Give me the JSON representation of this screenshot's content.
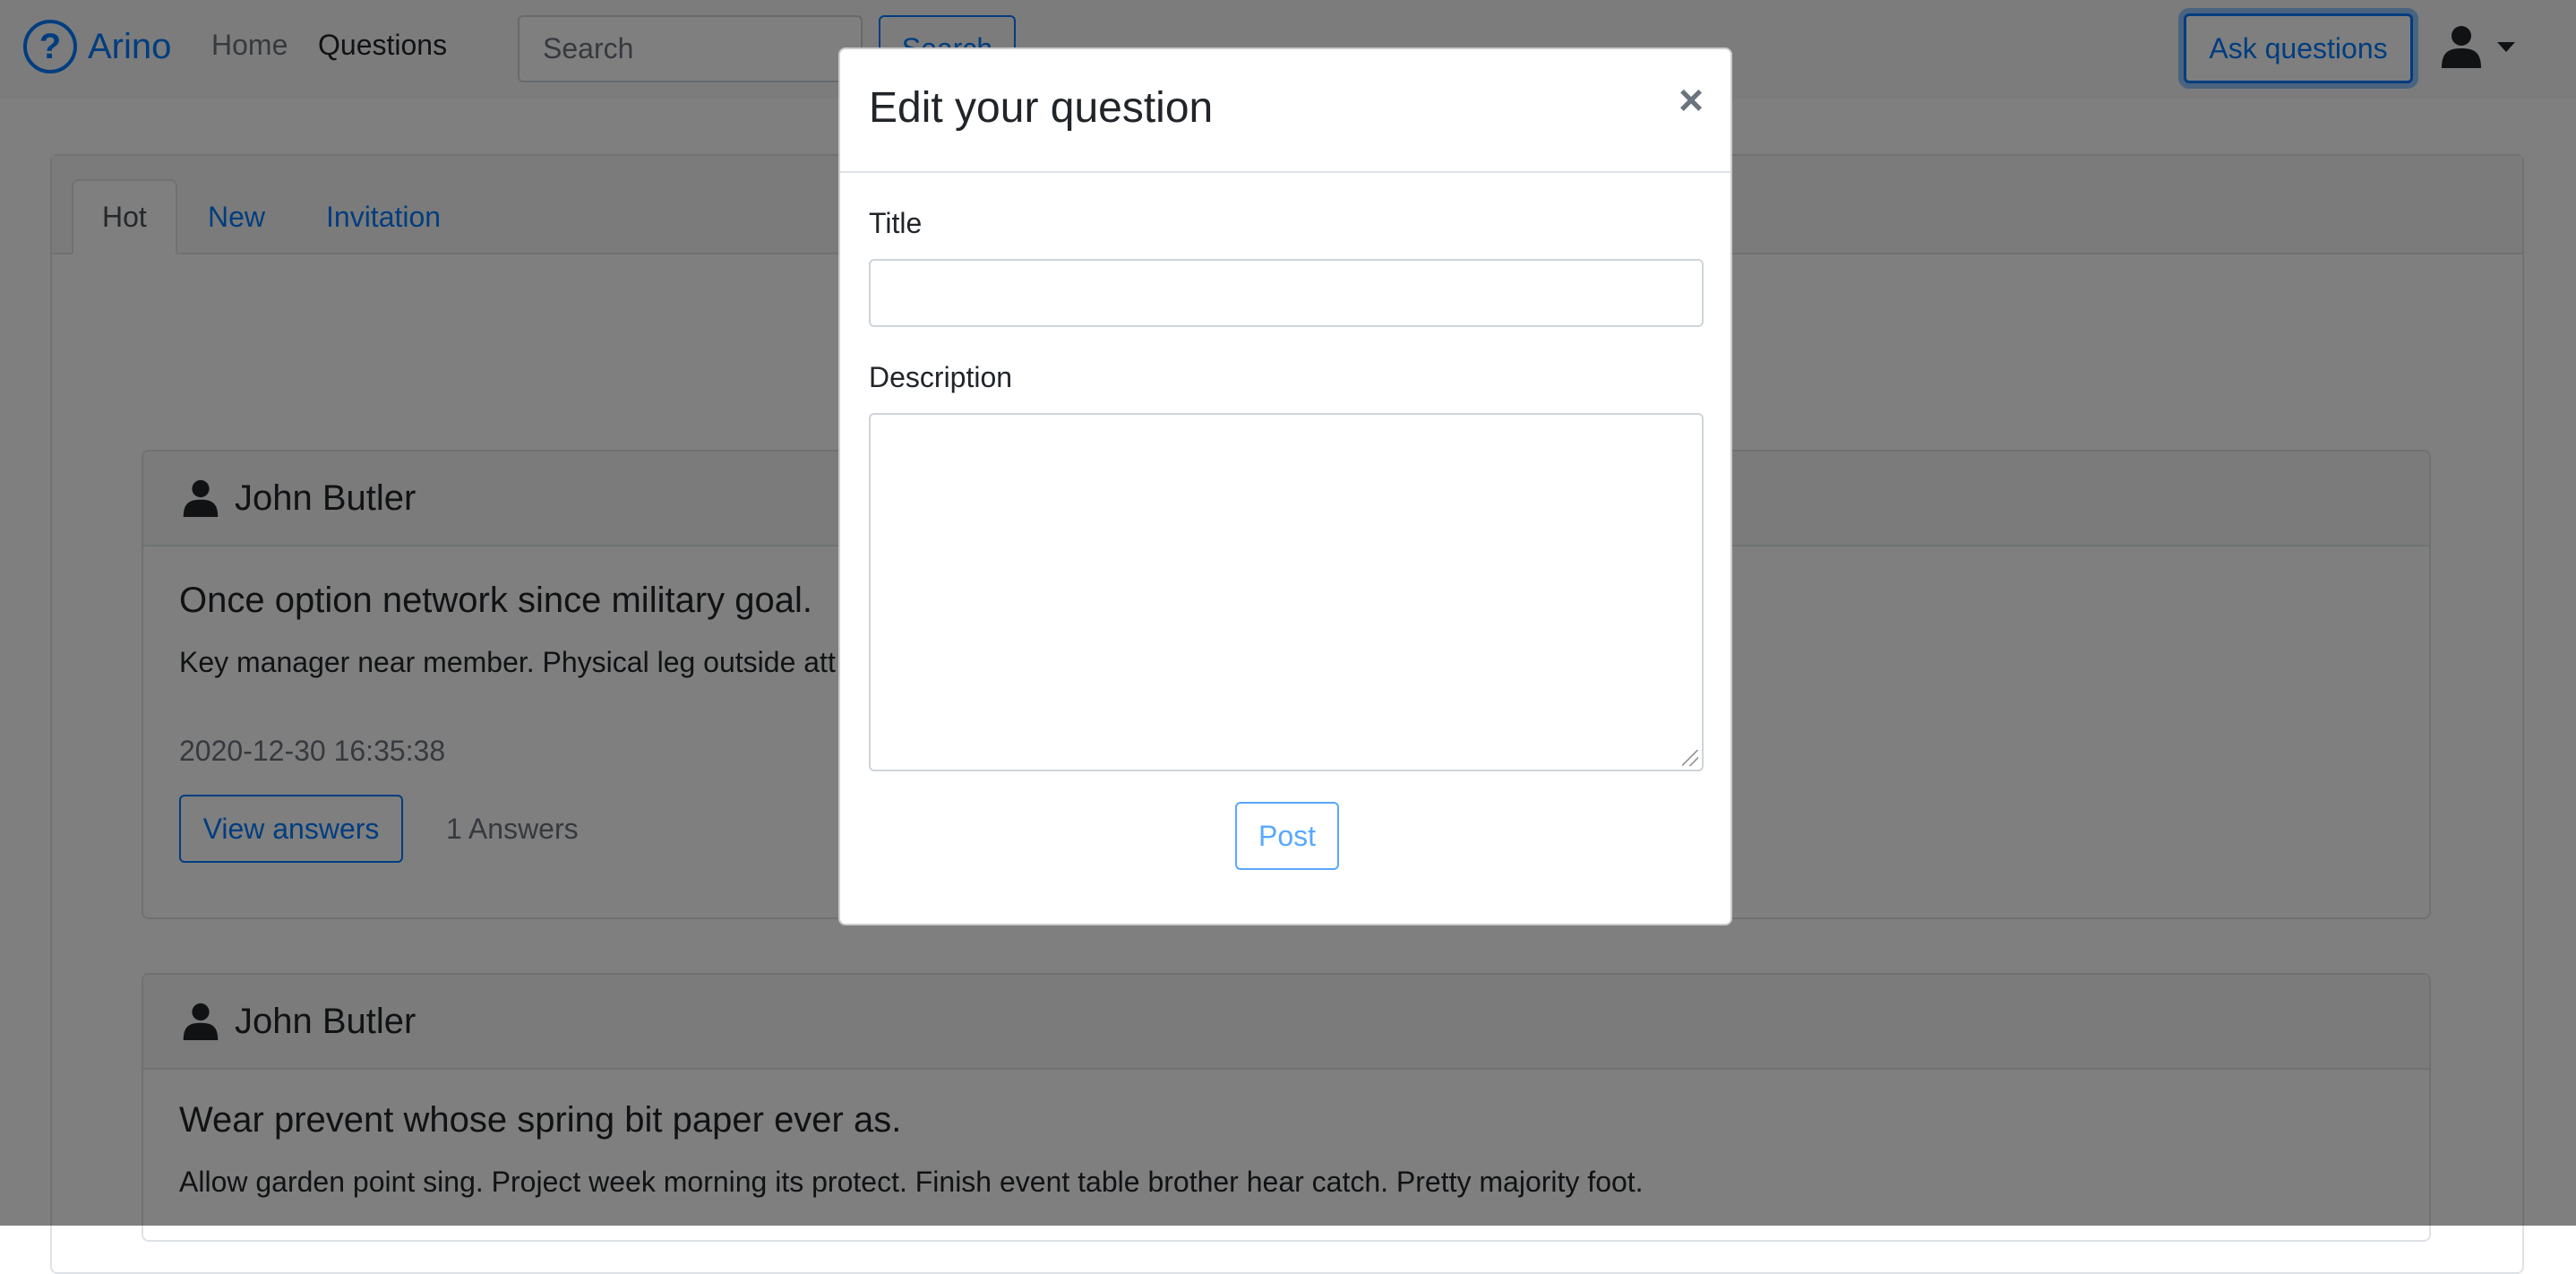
{
  "navbar": {
    "brand": "Arino",
    "brand_icon": "question-circle-icon",
    "links": [
      "Home",
      "Questions"
    ],
    "search_placeholder": "Search",
    "search_button": "Search",
    "ask_button": "Ask questions",
    "user_icon": "user-icon",
    "colors": {
      "accent": "#007bff"
    }
  },
  "tabs": [
    "Hot",
    "New",
    "Invitation"
  ],
  "questions": [
    {
      "author": "John Butler",
      "title": "Once option network since military goal.",
      "description": "Key manager near member. Physical leg outside att",
      "date": "2020-12-30 16:35:38",
      "view_button": "View answers",
      "answers": "1 Answers"
    },
    {
      "author": "John Butler",
      "title": "Wear prevent whose spring bit paper ever as.",
      "description": "Allow garden point sing. Project week morning its protect. Finish event table brother hear catch. Pretty majority foot."
    }
  ],
  "modal": {
    "title": "Edit your question",
    "close": "×",
    "title_label": "Title",
    "title_value": "",
    "description_label": "Description",
    "description_value": "",
    "post_button": "Post"
  }
}
